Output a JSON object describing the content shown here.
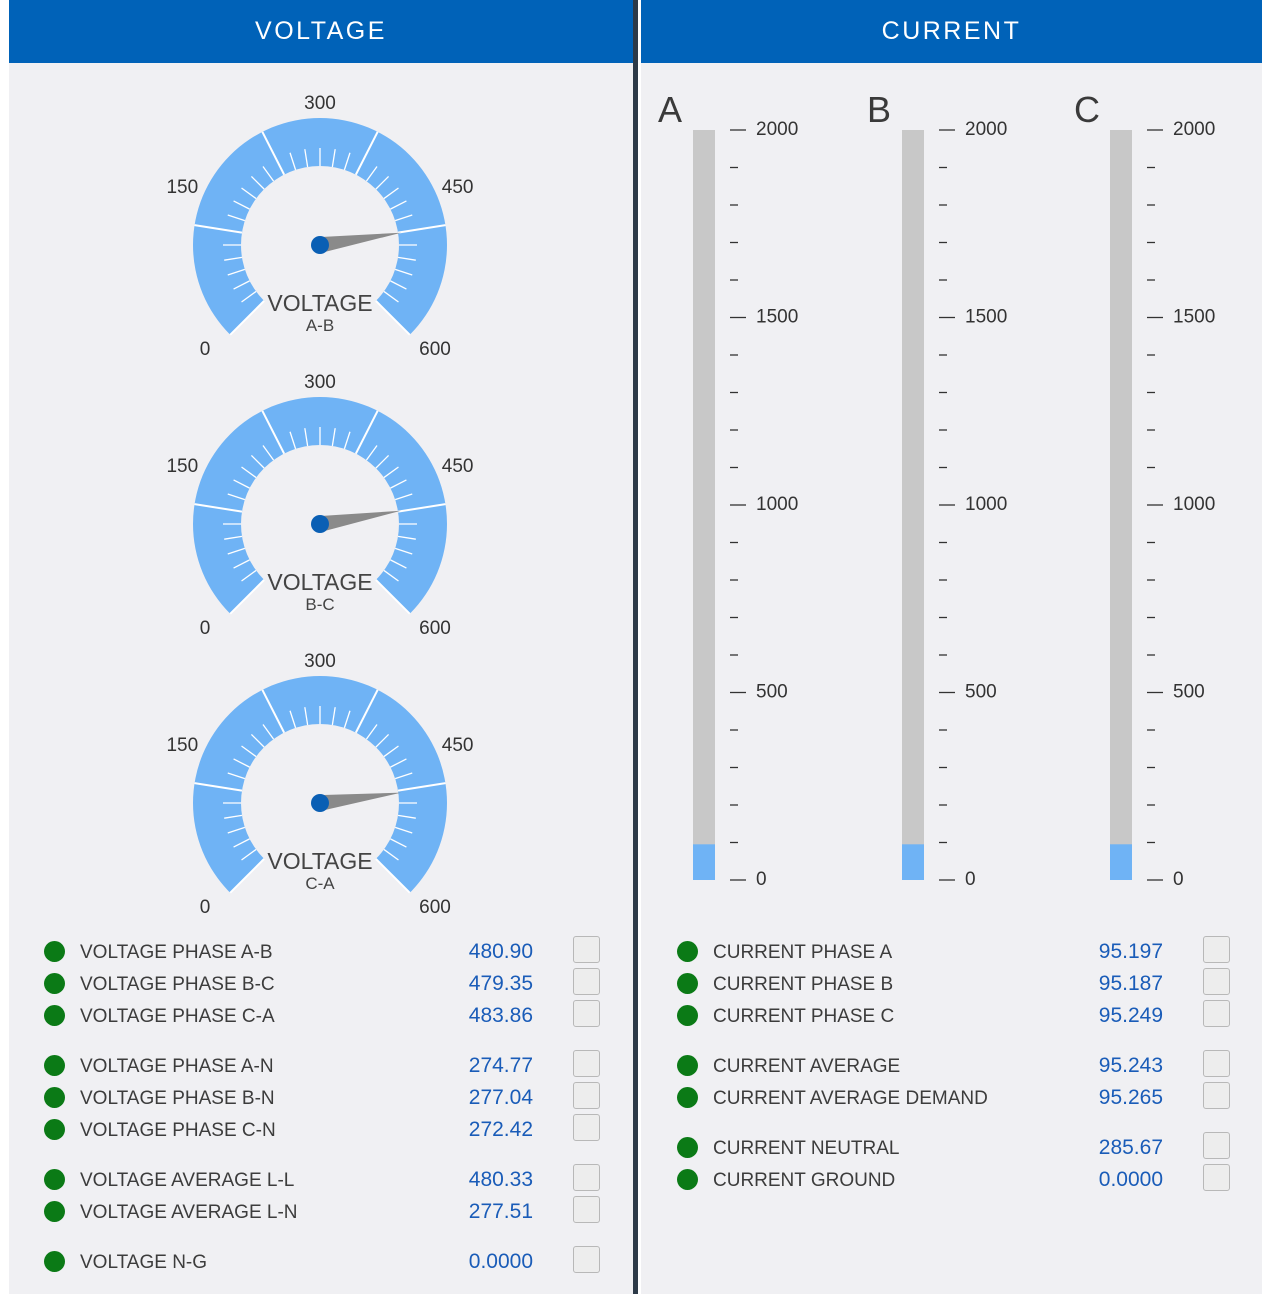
{
  "voltage": {
    "title": "VOLTAGE",
    "gauges": [
      {
        "label": "VOLTAGE",
        "sublabel": "A-B",
        "value": 480.9
      },
      {
        "label": "VOLTAGE",
        "sublabel": "B-C",
        "value": 479.35
      },
      {
        "label": "VOLTAGE",
        "sublabel": "C-A",
        "value": 483.86
      }
    ],
    "gauge_scale": {
      "min": 0,
      "max": 600,
      "tick_labels": [
        "0",
        "150",
        "300",
        "450",
        "600"
      ]
    },
    "readings": [
      {
        "label": "VOLTAGE PHASE A-B",
        "value": "480.90"
      },
      {
        "label": "VOLTAGE PHASE B-C",
        "value": "479.35"
      },
      {
        "label": "VOLTAGE PHASE C-A",
        "value": "483.86"
      },
      {
        "label": "VOLTAGE PHASE A-N",
        "value": "274.77"
      },
      {
        "label": "VOLTAGE PHASE B-N",
        "value": "277.04"
      },
      {
        "label": "VOLTAGE PHASE C-N",
        "value": "272.42"
      },
      {
        "label": "VOLTAGE AVERAGE L-L",
        "value": "480.33"
      },
      {
        "label": "VOLTAGE AVERAGE L-N",
        "value": "277.51"
      },
      {
        "label": "VOLTAGE N-G",
        "value": "0.0000"
      }
    ]
  },
  "current": {
    "title": "CURRENT",
    "bar_scale": {
      "min": 0,
      "max": 2000,
      "tick_labels": [
        "2000",
        "1500",
        "1000",
        "500",
        "0"
      ]
    },
    "bars": [
      {
        "label": "A",
        "value": 95.197
      },
      {
        "label": "B",
        "value": 95.187
      },
      {
        "label": "C",
        "value": 95.249
      }
    ],
    "readings": [
      {
        "label": "CURRENT PHASE A",
        "value": "95.197"
      },
      {
        "label": "CURRENT PHASE B",
        "value": "95.187"
      },
      {
        "label": "CURRENT PHASE C",
        "value": "95.249"
      },
      {
        "label": "CURRENT AVERAGE",
        "value": "95.243"
      },
      {
        "label": "CURRENT AVERAGE DEMAND",
        "value": "95.265"
      },
      {
        "label": "CURRENT NEUTRAL",
        "value": "285.67"
      },
      {
        "label": "CURRENT GROUND",
        "value": "0.0000"
      }
    ]
  },
  "colors": {
    "header": "#0062b8",
    "gauge_fill": "#6fb3f5",
    "bar_track": "#c8c8c8",
    "bar_fill": "#6fb3f5",
    "status_ok": "#0b7a16",
    "value_text": "#1a5cb8",
    "divider": "#2d3a48",
    "panel_bg": "#f0f0f3"
  },
  "icons": {
    "status": "status-dot-icon",
    "checkbox": "checkbox"
  }
}
